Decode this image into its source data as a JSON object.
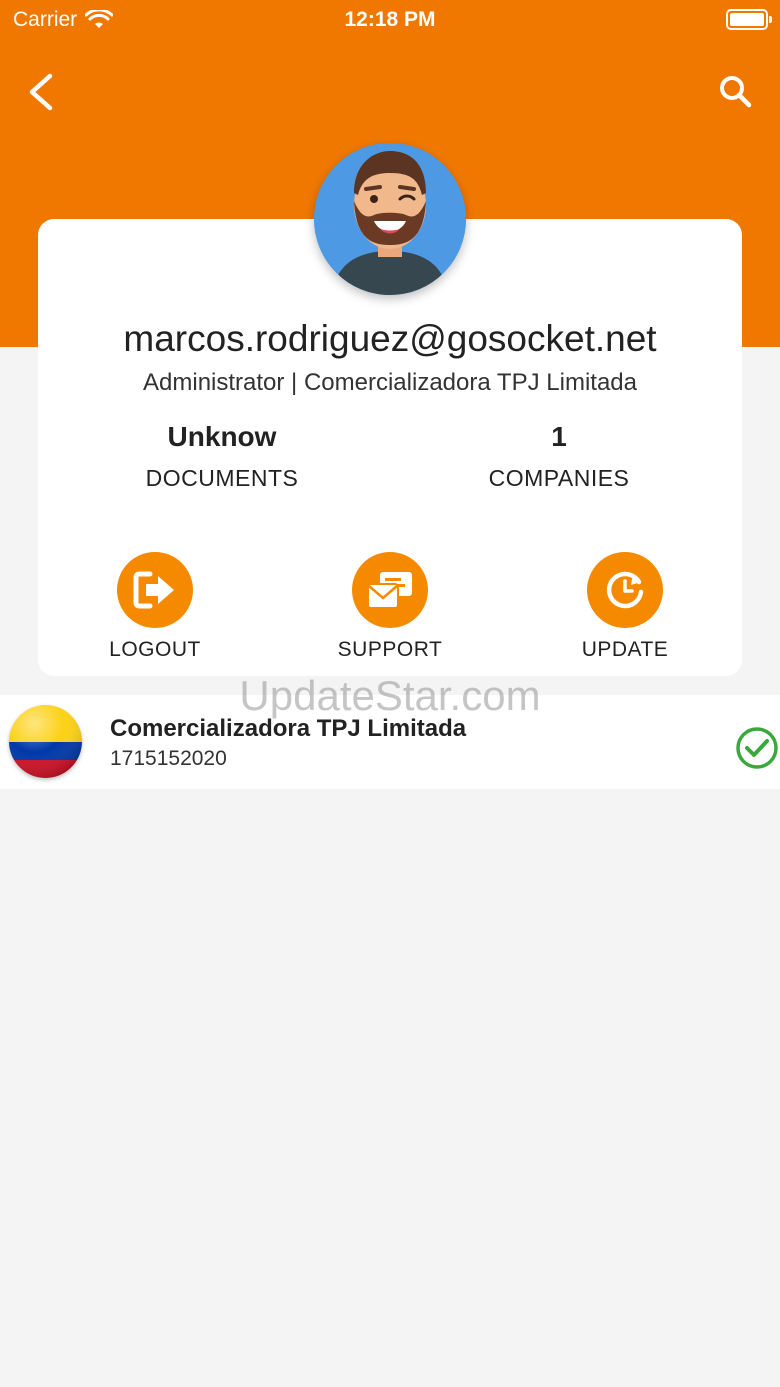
{
  "status_bar": {
    "carrier": "Carrier",
    "time": "12:18 PM"
  },
  "nav": {
    "back_icon": "chevron-left-icon",
    "search_icon": "search-icon"
  },
  "profile": {
    "email": "marcos.rodriguez@gosocket.net",
    "role": "Administrator | Comercializadora TPJ Limitada"
  },
  "stats": [
    {
      "value": "Unknow",
      "label": "DOCUMENTS"
    },
    {
      "value": "1",
      "label": "COMPANIES"
    }
  ],
  "actions": [
    {
      "label": "LOGOUT",
      "icon": "logout-icon"
    },
    {
      "label": "SUPPORT",
      "icon": "support-mail-icon"
    },
    {
      "label": "UPDATE",
      "icon": "update-clock-icon"
    }
  ],
  "companies": [
    {
      "name": "Comercializadora TPJ Limitada",
      "id": "1715152020",
      "flag": "colombia-flag-icon",
      "status_icon": "check-circle-icon"
    }
  ],
  "watermark": "UpdateStar.com",
  "colors": {
    "brand": "#f07800",
    "action": "#f58a00",
    "success": "#3aa83a",
    "background": "#f4f4f4"
  }
}
